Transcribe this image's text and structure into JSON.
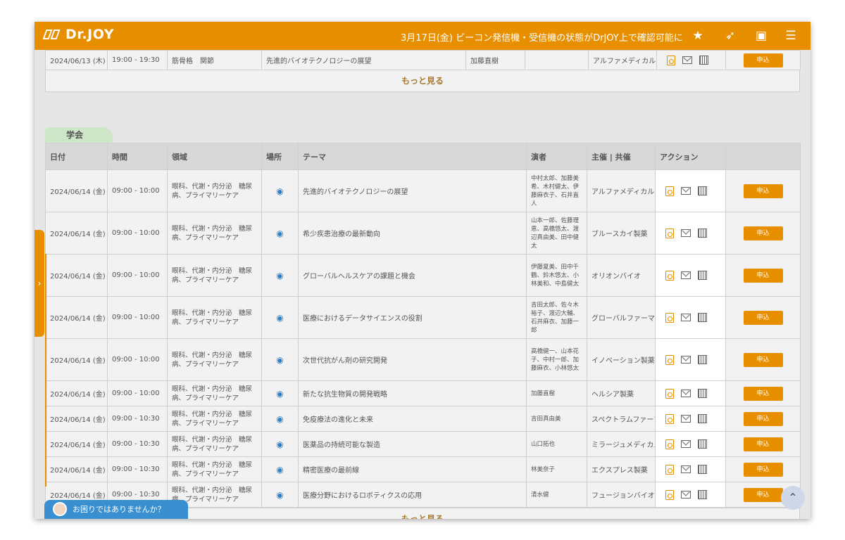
{
  "header": {
    "logo_text": "Dr.JOY",
    "notice": "3月17日(金) ビーコン発信機・受信機の状態がDrJOY上で確認可能に",
    "icons": [
      "star-icon",
      "send-icon",
      "play-icon",
      "menu-icon"
    ],
    "accent_color": "#e88f00"
  },
  "top_row": {
    "date": "2024/06/13 (木)",
    "time": "19:00 - 19:30",
    "field": "筋骨格　関節",
    "theme": "先進的バイオテクノロジーの展望",
    "speaker": "加藤直樹",
    "organizer": "アルファメディカル",
    "apply": "申込"
  },
  "more_label_top": "もっと見る",
  "section_tab": "学会",
  "columns": [
    "日付",
    "時間",
    "領域",
    "場所",
    "テーマ",
    "演者",
    "主催 | 共催",
    "アクション"
  ],
  "rows": [
    {
      "date": "2024/06/14 (金)",
      "time": "09:00 - 10:00",
      "field": "眼科、代謝・内分泌　糖尿病、プライマリーケア",
      "theme": "先進的バイオテクノロジーの展望",
      "speaker": "中村太郎、加藤美希、木村健太、伊藤麻衣子、石井直人",
      "organizer": "アルファメディカル",
      "apply": "申込"
    },
    {
      "date": "2024/06/14 (金)",
      "time": "09:00 - 10:00",
      "field": "眼科、代謝・内分泌　糖尿病、プライマリーケア",
      "theme": "希少疾患治療の最新動向",
      "speaker": "山本一郎、佐藤理恵、高橋悠太、渡辺真由美、田中健太",
      "organizer": "ブルースカイ製薬",
      "apply": "申込"
    },
    {
      "date": "2024/06/14 (金)",
      "time": "09:00 - 10:00",
      "field": "眼科、代謝・内分泌　糖尿病、プライマリーケア",
      "theme": "グローバルヘルスケアの課題と機会",
      "speaker": "伊藤夏美、田中千鶴、鈴木悠太、小林美和、中島健太",
      "organizer": "オリオンバイオ",
      "apply": "申込"
    },
    {
      "date": "2024/06/14 (金)",
      "time": "09:00 - 10:00",
      "field": "眼科、代謝・内分泌　糖尿病、プライマリーケア",
      "theme": "医療におけるデータサイエンスの役割",
      "speaker": "吉田太郎、佐々木裕子、渡辺大輔、石井麻衣、加藤一郎",
      "organizer": "グローバルファーマ",
      "apply": "申込"
    },
    {
      "date": "2024/06/14 (金)",
      "time": "09:00 - 10:00",
      "field": "眼科、代謝・内分泌　糖尿病、プライマリーケア",
      "theme": "次世代抗がん剤の研究開発",
      "speaker": "高橋健一、山本花子、中村一郎、加藤麻衣、小林悠太",
      "organizer": "イノベーション製薬",
      "apply": "申込"
    },
    {
      "date": "2024/06/14 (金)",
      "time": "09:00 - 10:00",
      "field": "眼科、代謝・内分泌　糖尿病、プライマリーケア",
      "theme": "新たな抗生物質の開発戦略",
      "speaker": "加藤直樹",
      "organizer": "ヘルシア製薬",
      "apply": "申込"
    },
    {
      "date": "2024/06/14 (金)",
      "time": "09:00 - 10:30",
      "field": "眼科、代謝・内分泌　糖尿病、プライマリーケア",
      "theme": "免疫療法の進化と未来",
      "speaker": "吉田真由美",
      "organizer": "スペクトラムファーマ",
      "apply": "申込"
    },
    {
      "date": "2024/06/14 (金)",
      "time": "09:00 - 10:30",
      "field": "眼科、代謝・内分泌　糖尿病、プライマリーケア",
      "theme": "医薬品の持続可能な製造",
      "speaker": "山口拓也",
      "organizer": "ミラージュメディカル",
      "apply": "申込"
    },
    {
      "date": "2024/06/14 (金)",
      "time": "09:00 - 10:30",
      "field": "眼科、代謝・内分泌　糖尿病、プライマリーケア",
      "theme": "精密医療の最前線",
      "speaker": "林美奈子",
      "organizer": "エクスプレス製薬",
      "apply": "申込"
    },
    {
      "date": "2024/06/14 (金)",
      "time": "09:00 - 10:30",
      "field": "眼科、代謝・内分泌　糖尿病、プライマリーケア",
      "theme": "医療分野におけるロボティクスの応用",
      "speaker": "清水健",
      "organizer": "フュージョンバイオ",
      "apply": "申込"
    }
  ],
  "more_label_bottom": "もっと見る",
  "help_label": "お困りではありませんか？"
}
